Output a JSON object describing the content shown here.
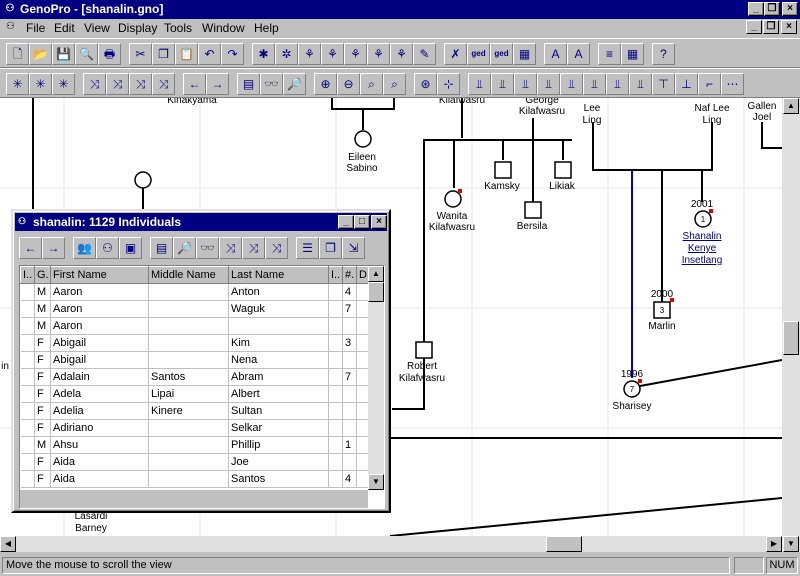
{
  "window": {
    "title": "GenoPro - [shanalin.gno]"
  },
  "menu": [
    "File",
    "Edit",
    "View",
    "Display",
    "Tools",
    "Window",
    "Help"
  ],
  "toolbar1": [
    {
      "name": "new-icon",
      "glyph": "🗋"
    },
    {
      "name": "open-icon",
      "glyph": "📂"
    },
    {
      "name": "save-icon",
      "glyph": "💾"
    },
    {
      "name": "print-preview-icon",
      "glyph": "🔍"
    },
    {
      "name": "print-icon",
      "glyph": "🖶"
    },
    {
      "name": "cut-icon",
      "glyph": "✂"
    },
    {
      "name": "copy-icon",
      "glyph": "❐"
    },
    {
      "name": "paste-icon",
      "glyph": "📋"
    },
    {
      "name": "undo-icon",
      "glyph": "↶"
    },
    {
      "name": "redo-icon",
      "glyph": "↷"
    },
    {
      "name": "new-individual-icon",
      "glyph": "✱"
    },
    {
      "name": "new-family-icon",
      "glyph": "✲"
    },
    {
      "name": "insert-parents-icon",
      "glyph": "⚘"
    },
    {
      "name": "insert-children-icon",
      "glyph": "⚘"
    },
    {
      "name": "insert-sibling-icon",
      "glyph": "⚘"
    },
    {
      "name": "insert-spouse-icon",
      "glyph": "⚘"
    },
    {
      "name": "pedigree-icon",
      "glyph": "⚘"
    },
    {
      "name": "marker-icon",
      "glyph": "✎"
    },
    {
      "name": "genealogy-icon",
      "glyph": "✗"
    },
    {
      "name": "ged-export-icon",
      "glyph": "ged"
    },
    {
      "name": "ged-html-icon",
      "glyph": "ged"
    },
    {
      "name": "report-icon",
      "glyph": "▦"
    },
    {
      "name": "font-larger-icon",
      "glyph": "A"
    },
    {
      "name": "font-smaller-icon",
      "glyph": "A"
    },
    {
      "name": "layers-icon",
      "glyph": "≡"
    },
    {
      "name": "grid-icon",
      "glyph": "▦"
    },
    {
      "name": "help-icon",
      "glyph": "?"
    }
  ],
  "toolbar2": [
    {
      "name": "select-icon",
      "glyph": "✳"
    },
    {
      "name": "select-family-icon",
      "glyph": "✳"
    },
    {
      "name": "select-all-icon",
      "glyph": "✳"
    },
    {
      "name": "tree-ancestors-icon",
      "glyph": "⤨"
    },
    {
      "name": "tree-descendants-icon",
      "glyph": "⤨"
    },
    {
      "name": "tree-links-icon",
      "glyph": "⤨"
    },
    {
      "name": "tree-swap-icon",
      "glyph": "⤨"
    },
    {
      "name": "arrow-left-icon",
      "glyph": "←"
    },
    {
      "name": "arrow-right-icon",
      "glyph": "→"
    },
    {
      "name": "properties-icon",
      "glyph": "▤"
    },
    {
      "name": "find-icon",
      "glyph": "👓"
    },
    {
      "name": "find-next-icon",
      "glyph": "🔎"
    },
    {
      "name": "zoom-in-icon",
      "glyph": "⊕"
    },
    {
      "name": "zoom-out-icon",
      "glyph": "⊖"
    },
    {
      "name": "zoom-icon",
      "glyph": "⌕"
    },
    {
      "name": "zoom-fit-icon",
      "glyph": "⌕"
    },
    {
      "name": "hyperlink-icon",
      "glyph": "⊛"
    },
    {
      "name": "center-icon",
      "glyph": "⊹"
    },
    {
      "name": "align-top-icon",
      "glyph": "⫫"
    },
    {
      "name": "align-bottom-icon",
      "glyph": "⫫"
    },
    {
      "name": "align-left-icon",
      "glyph": "⫫"
    },
    {
      "name": "align-right-icon",
      "glyph": "⫫"
    },
    {
      "name": "align-center-icon",
      "glyph": "⫫"
    },
    {
      "name": "align-middle-icon",
      "glyph": "⫫"
    },
    {
      "name": "space-icon",
      "glyph": "⫫"
    },
    {
      "name": "straight-icon",
      "glyph": "⫫"
    },
    {
      "name": "compact-icon",
      "glyph": "⊤"
    },
    {
      "name": "expand-icon",
      "glyph": "⊥"
    },
    {
      "name": "collapse-icon",
      "glyph": "⌐"
    },
    {
      "name": "more-icon",
      "glyph": "⋯"
    }
  ],
  "chart_labels": [
    {
      "text": "Kinakyama",
      "cls": ""
    },
    {
      "text": "Kilafwasru",
      "cls": ""
    },
    {
      "text": "George",
      "cls": ""
    },
    {
      "text": "Kilafwasru",
      "cls": ""
    },
    {
      "text": "Lee",
      "cls": ""
    },
    {
      "text": "Ling",
      "cls": ""
    },
    {
      "text": "Naf Lee",
      "cls": ""
    },
    {
      "text": "Ling",
      "cls": ""
    },
    {
      "text": "Gallen",
      "cls": ""
    },
    {
      "text": "Joel",
      "cls": ""
    },
    {
      "text": "Eileen",
      "cls": ""
    },
    {
      "text": "Sabino",
      "cls": ""
    },
    {
      "text": "Kamsky",
      "cls": ""
    },
    {
      "text": "Likiak",
      "cls": ""
    },
    {
      "text": "Wanita",
      "cls": ""
    },
    {
      "text": "Kilafwasru",
      "cls": ""
    },
    {
      "text": "Bersila",
      "cls": ""
    },
    {
      "text": "2001",
      "cls": ""
    },
    {
      "text": "Shanalin",
      "cls": "link"
    },
    {
      "text": "Kenye",
      "cls": "link"
    },
    {
      "text": "Insetlang",
      "cls": "link"
    },
    {
      "text": "2000",
      "cls": ""
    },
    {
      "text": "Marlin",
      "cls": ""
    },
    {
      "text": "Robert",
      "cls": ""
    },
    {
      "text": "Kilafwasru",
      "cls": ""
    },
    {
      "text": "1996",
      "cls": ""
    },
    {
      "text": "Sharisey",
      "cls": ""
    },
    {
      "text": "in",
      "cls": ""
    },
    {
      "text": "Lasardi",
      "cls": ""
    },
    {
      "text": "Barney",
      "cls": ""
    }
  ],
  "symbol_numbers": [
    "1",
    "3",
    "7"
  ],
  "child_window": {
    "title": "shanalin: 1129 Individuals",
    "toolbar": [
      {
        "name": "back-icon",
        "glyph": "←"
      },
      {
        "name": "forward-icon",
        "glyph": "→"
      },
      {
        "name": "individuals-icon",
        "glyph": "👥"
      },
      {
        "name": "families-icon",
        "glyph": "⚇"
      },
      {
        "name": "pictures-icon",
        "glyph": "▣"
      },
      {
        "name": "properties-icon",
        "glyph": "▤"
      },
      {
        "name": "find-icon",
        "glyph": "🔎"
      },
      {
        "name": "binoculars-icon",
        "glyph": "👓"
      },
      {
        "name": "tree-up-icon",
        "glyph": "⤨"
      },
      {
        "name": "tree-down-icon",
        "glyph": "⤨"
      },
      {
        "name": "tree-link-icon",
        "glyph": "⤨"
      },
      {
        "name": "list-icon",
        "glyph": "☰"
      },
      {
        "name": "copy-icon",
        "glyph": "❐"
      },
      {
        "name": "export-icon",
        "glyph": "⇲"
      }
    ],
    "columns": [
      "I..",
      "G.",
      "First Name",
      "Middle Name",
      "Last Name",
      "I..",
      "#.",
      "D"
    ],
    "rows": [
      [
        "",
        "M",
        "Aaron",
        "",
        "Anton",
        "",
        "4",
        ""
      ],
      [
        "",
        "M",
        "Aaron",
        "",
        "Waguk",
        "",
        "7",
        ""
      ],
      [
        "",
        "M",
        "Aaron",
        "",
        "",
        "",
        "",
        ""
      ],
      [
        "",
        "F",
        "Abigail",
        "",
        "Kim",
        "",
        "3",
        ""
      ],
      [
        "",
        "F",
        "Abigail",
        "",
        "Nena",
        "",
        "",
        ""
      ],
      [
        "",
        "F",
        "Adalain",
        "Santos",
        "Abram",
        "",
        "7",
        ""
      ],
      [
        "",
        "F",
        "Adela",
        "Lipai",
        "Albert",
        "",
        "",
        ""
      ],
      [
        "",
        "F",
        "Adelia",
        "Kinere",
        "Sultan",
        "",
        "",
        ""
      ],
      [
        "",
        "F",
        "Adiriano",
        "",
        "Selkar",
        "",
        "",
        ""
      ],
      [
        "",
        "M",
        "Ahsu",
        "",
        "Phillip",
        "",
        "1",
        ""
      ],
      [
        "",
        "F",
        "Aida",
        "",
        "Joe",
        "",
        "",
        ""
      ],
      [
        "",
        "F",
        "Aida",
        "",
        "Santos",
        "",
        "4",
        ""
      ]
    ]
  },
  "status": {
    "message": "Move the mouse to scroll the view",
    "num": "NUM"
  }
}
